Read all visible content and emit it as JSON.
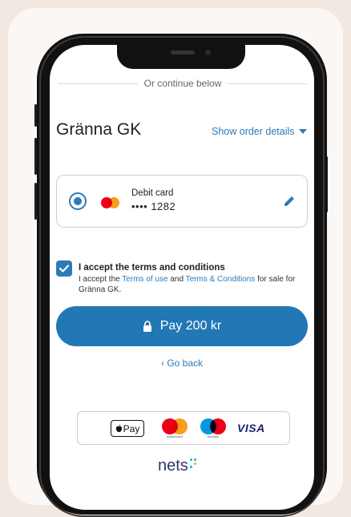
{
  "divider": {
    "text": "Or continue below"
  },
  "merchant": {
    "name": "Gränna GK"
  },
  "order_link": {
    "label": "Show order details"
  },
  "card": {
    "type": "Debit card",
    "number": "•••• 1282",
    "brand_icon": "mastercard-icon",
    "edit_icon": "pencil-icon"
  },
  "terms": {
    "title": "I accept the terms and conditions",
    "text_1": "I accept the ",
    "link_1": "Terms of use",
    "text_2": " and ",
    "link_2": "Terms & Conditions",
    "text_3": " for sale for Gränna GK.",
    "checked": true
  },
  "pay_button": {
    "label": "Pay 200 kr",
    "icon": "lock-icon"
  },
  "back_link": {
    "label": "‹ Go back"
  },
  "payment_logos": {
    "apple_pay": "Pay",
    "mastercard": "mastercard",
    "maestro": "maestro",
    "visa": "VISA"
  },
  "footer_brand": {
    "name": "nets"
  },
  "colors": {
    "accent": "#2277b5",
    "link": "#2b7bb9",
    "background": "#f1e8e1"
  }
}
